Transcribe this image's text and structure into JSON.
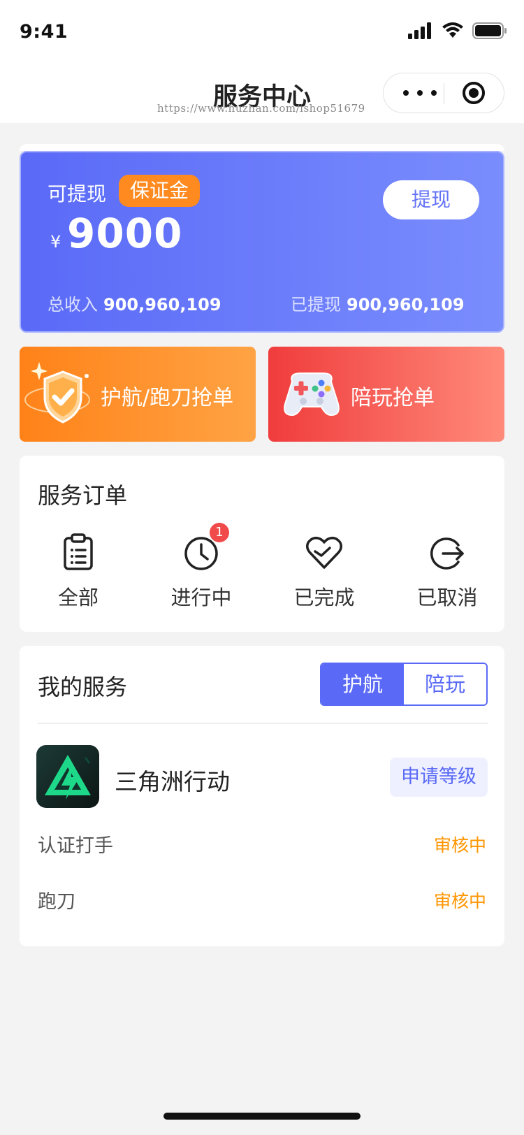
{
  "status_bar": {
    "time": "9:41"
  },
  "nav": {
    "title": "服务中心",
    "watermark": "https://www.huzhan.com/ishop51679"
  },
  "balance": {
    "label": "可提现",
    "deposit_badge": "保证金",
    "currency": "¥",
    "amount": "9000",
    "withdraw_button": "提现",
    "total_income_label": "总收入",
    "total_income_value": "900,960,109",
    "withdrawn_label": "已提现",
    "withdrawn_value": "900,960,109"
  },
  "grab_buttons": {
    "escort": "护航/跑刀抢单",
    "play": "陪玩抢单"
  },
  "orders": {
    "title": "服务订单",
    "items": [
      {
        "label": "全部",
        "icon": "clipboard-icon"
      },
      {
        "label": "进行中",
        "icon": "clock-icon",
        "badge": "1"
      },
      {
        "label": "已完成",
        "icon": "heart-check-icon"
      },
      {
        "label": "已取消",
        "icon": "exit-icon"
      }
    ]
  },
  "services": {
    "title": "我的服务",
    "tabs": [
      "护航",
      "陪玩"
    ],
    "active_tab": "护航",
    "game": {
      "name": "三角洲行动",
      "apply_button": "申请等级"
    },
    "rows": [
      {
        "label": "认证打手",
        "status": "审核中"
      },
      {
        "label": "跑刀",
        "status": "审核中"
      }
    ]
  },
  "colors": {
    "accent": "#5a6af7",
    "orange": "#ff8a1f",
    "red": "#f03c3c",
    "pending": "#ff9500"
  }
}
